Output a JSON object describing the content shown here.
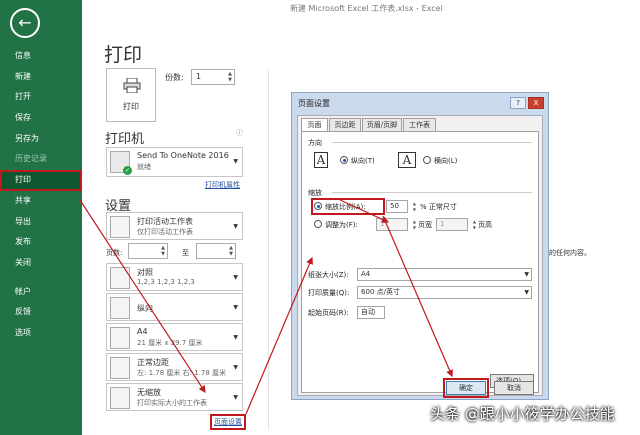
{
  "window": {
    "title": "新建 Microsoft Excel 工作表.xlsx  -  Excel"
  },
  "sidebar": {
    "back_icon": "back-arrow-icon",
    "items": [
      "信息",
      "新建",
      "打开",
      "保存",
      "另存为",
      "历史记录",
      "打印",
      "共享",
      "导出",
      "发布",
      "关闭",
      "帐户",
      "反馈",
      "选项"
    ],
    "active": "打印",
    "disabled": [
      "历史记录"
    ]
  },
  "print": {
    "title": "打印",
    "print_button": "打印",
    "copies_label": "份数:",
    "copies_value": "1",
    "printer_section": "打印机",
    "printer_name": "Send To OneNote 2016",
    "printer_status": "就绪",
    "printer_props": "打印机属性",
    "settings_section": "设置",
    "options": [
      {
        "title": "打印活动工作表",
        "desc": "仅打印活动工作表"
      },
      {
        "title": "对照",
        "desc": "1,2,3    1,2,3    1,2,3"
      },
      {
        "title": "纵向",
        "desc": ""
      },
      {
        "title": "A4",
        "desc": "21 厘米 x 29.7 厘米"
      },
      {
        "title": "正常边距",
        "desc": "左: 1.78 厘米    右: 1.78 厘米"
      },
      {
        "title": "无缩放",
        "desc": "打印实际大小的工作表"
      }
    ],
    "pages_label": "页数:",
    "to_label": "至",
    "page_setup_link": "页面设置",
    "preview_text": "的任何内容。"
  },
  "dialog": {
    "title": "页面设置",
    "help": "?",
    "close": "X",
    "tabs": [
      "页面",
      "页边距",
      "页眉/页脚",
      "工作表"
    ],
    "orientation": {
      "label": "方向",
      "portrait": "纵向(T)",
      "landscape": "横向(L)"
    },
    "scaling": {
      "label": "缩放",
      "adjust_label": "缩放比例(A):",
      "adjust_value": "50",
      "adjust_suffix": "% 正常尺寸",
      "fit_label": "调整为(F):",
      "fit_wide": "1",
      "fit_wide_suffix": "页宽",
      "fit_tall": "1",
      "fit_tall_suffix": "页高"
    },
    "paper_size": {
      "label": "纸张大小(Z):",
      "value": "A4"
    },
    "print_quality": {
      "label": "打印质量(Q):",
      "value": "600 点/英寸"
    },
    "first_page": {
      "label": "起始页码(R):",
      "value": "自动"
    },
    "options_button": "选项(O)...",
    "ok": "确定",
    "cancel": "取消"
  },
  "watermark": "头条 @跟小小筱学办公技能",
  "colors": {
    "sidebar": "#217346",
    "highlight": "#c0191f",
    "dialog": "#cbd9ec"
  }
}
